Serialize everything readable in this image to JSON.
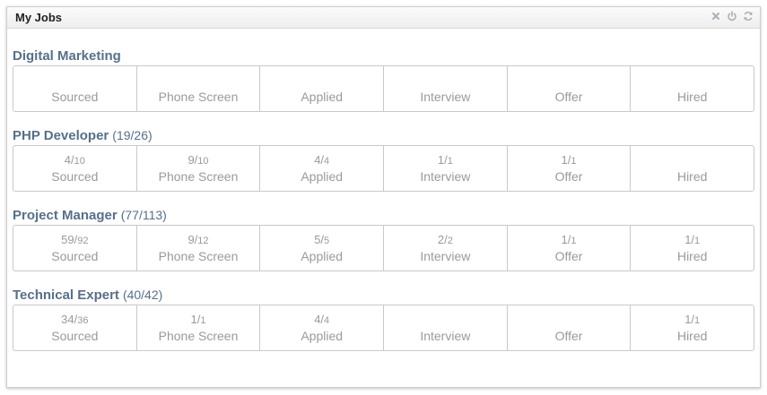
{
  "widget": {
    "title": "My Jobs",
    "icons": [
      "close-icon",
      "power-icon",
      "refresh-icon"
    ]
  },
  "stage_names": [
    "Sourced",
    "Phone Screen",
    "Applied",
    "Interview",
    "Offer",
    "Hired"
  ],
  "jobs": [
    {
      "name": "Digital Marketing",
      "count": "",
      "stages": [
        {
          "label": "Sourced",
          "num": "",
          "den": ""
        },
        {
          "label": "Phone Screen",
          "num": "",
          "den": ""
        },
        {
          "label": "Applied",
          "num": "",
          "den": ""
        },
        {
          "label": "Interview",
          "num": "",
          "den": ""
        },
        {
          "label": "Offer",
          "num": "",
          "den": ""
        },
        {
          "label": "Hired",
          "num": "",
          "den": ""
        }
      ]
    },
    {
      "name": "PHP Developer",
      "count": "(19/26)",
      "stages": [
        {
          "label": "Sourced",
          "num": "4/",
          "den": "10"
        },
        {
          "label": "Phone Screen",
          "num": "9/",
          "den": "10"
        },
        {
          "label": "Applied",
          "num": "4/",
          "den": "4"
        },
        {
          "label": "Interview",
          "num": "1/",
          "den": "1"
        },
        {
          "label": "Offer",
          "num": "1/",
          "den": "1"
        },
        {
          "label": "Hired",
          "num": "",
          "den": ""
        }
      ]
    },
    {
      "name": "Project Manager",
      "count": "(77/113)",
      "stages": [
        {
          "label": "Sourced",
          "num": "59/",
          "den": "92"
        },
        {
          "label": "Phone Screen",
          "num": "9/",
          "den": "12"
        },
        {
          "label": "Applied",
          "num": "5/",
          "den": "5"
        },
        {
          "label": "Interview",
          "num": "2/",
          "den": "2"
        },
        {
          "label": "Offer",
          "num": "1/",
          "den": "1"
        },
        {
          "label": "Hired",
          "num": "1/",
          "den": "1"
        }
      ]
    },
    {
      "name": "Technical Expert",
      "count": "(40/42)",
      "stages": [
        {
          "label": "Sourced",
          "num": "34/",
          "den": "36"
        },
        {
          "label": "Phone Screen",
          "num": "1/",
          "den": "1"
        },
        {
          "label": "Applied",
          "num": "4/",
          "den": "4"
        },
        {
          "label": "Interview",
          "num": "",
          "den": ""
        },
        {
          "label": "Offer",
          "num": "",
          "den": ""
        },
        {
          "label": "Hired",
          "num": "1/",
          "den": "1"
        }
      ]
    }
  ],
  "colors": {
    "job_title": "#55708c",
    "stage_text": "#9a9a9a",
    "border": "#c9c9c9",
    "icon": "#a8b0b8"
  }
}
